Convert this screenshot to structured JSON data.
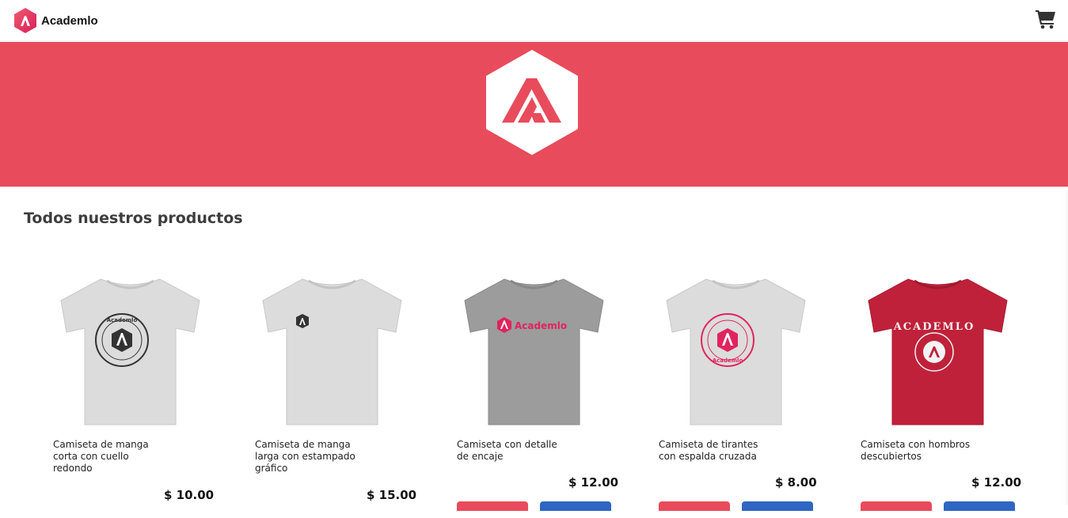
{
  "navbar": {
    "brand_name": "Academlo",
    "cart_icon": "shopping-cart-icon"
  },
  "hero": {
    "logo": "academlo-hexagon-logo"
  },
  "colors": {
    "brand_red": "#e84b5b",
    "button_blue": "#2f65c3"
  },
  "section": {
    "title": "Todos nuestros productos"
  },
  "products": [
    {
      "name": "Camiseta de manga corta con cuello redondo",
      "price": "$ 10.00",
      "shirt_color": "#dcdcdc",
      "print": "black circle badge"
    },
    {
      "name": "Camiseta de manga larga con estampado gráfico",
      "price": "$ 15.00",
      "shirt_color": "#dcdcdc",
      "print": "small black logo"
    },
    {
      "name": "Camiseta con detalle de encaje",
      "price": "$ 12.00",
      "shirt_color": "#9c9c9c",
      "print": "pink Academlo wordmark"
    },
    {
      "name": "Camiseta de tirantes con espalda cruzada",
      "price": "$ 8.00",
      "shirt_color": "#dcdcdc",
      "print": "pink circle badge"
    },
    {
      "name": "Camiseta con hombros descubiertos",
      "price": "$ 12.00",
      "shirt_color": "#c0213a",
      "print": "white ACADEMLO badge"
    }
  ]
}
